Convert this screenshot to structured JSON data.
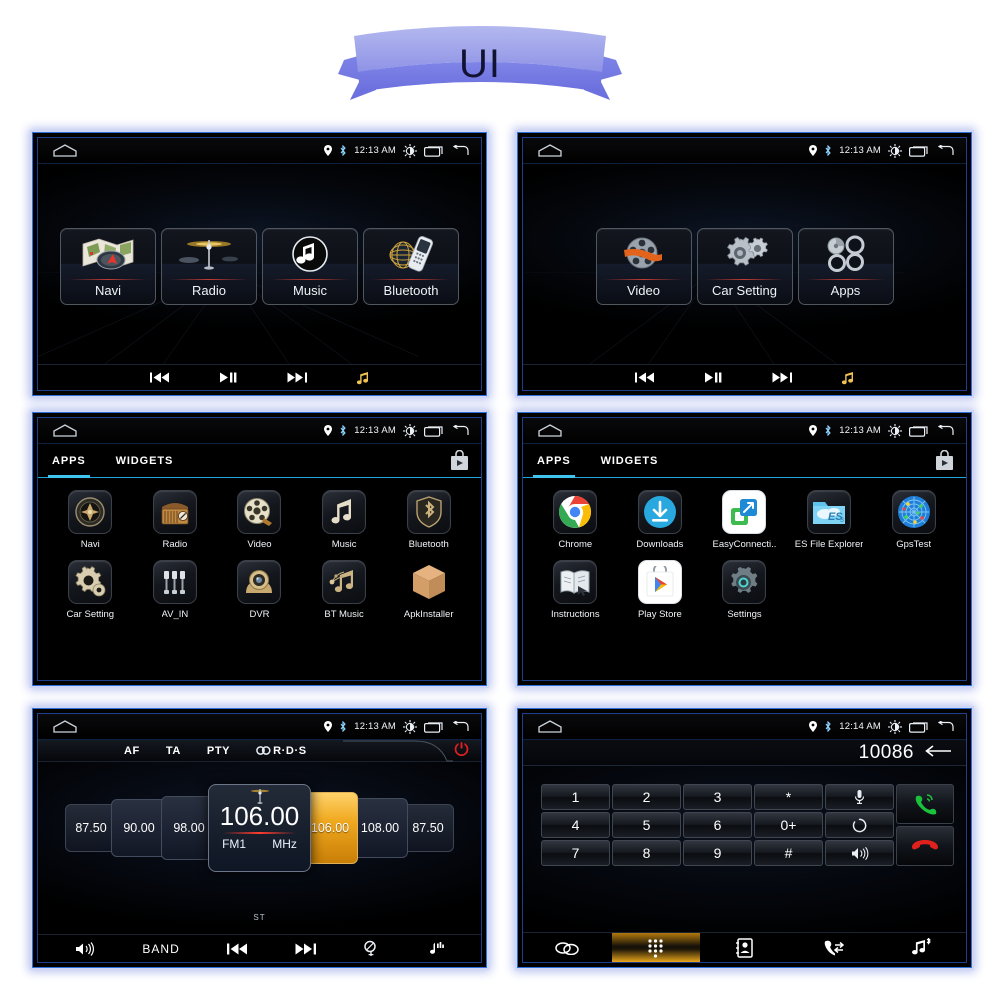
{
  "banner": {
    "title": "UI"
  },
  "status_bar": {
    "time_12_13": "12:13 AM",
    "time_12_14": "12:14 AM",
    "icons": [
      "home-icon",
      "location-icon",
      "bluetooth-icon",
      "brightness-icon",
      "recents-icon",
      "back-icon"
    ]
  },
  "panel1_home": {
    "tiles": [
      {
        "label": "Navi",
        "icon": "map-icon"
      },
      {
        "label": "Radio",
        "icon": "radio-tower-icon"
      },
      {
        "label": "Music",
        "icon": "music-note-icon"
      },
      {
        "label": "Bluetooth",
        "icon": "bt-phone-icon"
      }
    ],
    "media_controls": [
      "prev-icon",
      "play-pause-icon",
      "next-icon",
      "music-icon"
    ]
  },
  "panel2_home": {
    "tiles": [
      {
        "label": "Video",
        "icon": "film-reel-icon"
      },
      {
        "label": "Car Setting",
        "icon": "gears-icon"
      },
      {
        "label": "Apps",
        "icon": "rings-icon"
      }
    ],
    "media_controls": [
      "prev-icon",
      "play-pause-icon",
      "next-icon",
      "music-icon"
    ]
  },
  "panel3_drawer": {
    "tabs": [
      {
        "label": "APPS",
        "active": true
      },
      {
        "label": "WIDGETS",
        "active": false
      }
    ],
    "store_icon": "play-store-bag-icon",
    "apps": [
      {
        "label": "Navi",
        "icon": "compass-icon"
      },
      {
        "label": "Radio",
        "icon": "retro-radio-icon"
      },
      {
        "label": "Video",
        "icon": "film-reel-icon"
      },
      {
        "label": "Music",
        "icon": "music-note-icon"
      },
      {
        "label": "Bluetooth",
        "icon": "bt-shield-icon"
      },
      {
        "label": "Car Setting",
        "icon": "gears-icon"
      },
      {
        "label": "AV_IN",
        "icon": "rca-jacks-icon"
      },
      {
        "label": "DVR",
        "icon": "camera-icon"
      },
      {
        "label": "BT Music",
        "icon": "bt-music-icon"
      },
      {
        "label": "ApkInstaller",
        "icon": "box-icon"
      }
    ]
  },
  "panel4_drawer": {
    "tabs": [
      {
        "label": "APPS",
        "active": true
      },
      {
        "label": "WIDGETS",
        "active": false
      }
    ],
    "store_icon": "play-store-bag-icon",
    "apps": [
      {
        "label": "Chrome",
        "icon": "chrome-icon"
      },
      {
        "label": "Downloads",
        "icon": "download-icon"
      },
      {
        "label": "EasyConnecti..",
        "icon": "easyconnection-icon"
      },
      {
        "label": "ES File Explorer",
        "icon": "es-folder-icon"
      },
      {
        "label": "GpsTest",
        "icon": "gps-radar-icon"
      },
      {
        "label": "Instructions",
        "icon": "book-icon"
      },
      {
        "label": "Play Store",
        "icon": "play-store-icon"
      },
      {
        "label": "Settings",
        "icon": "settings-gear-icon"
      }
    ]
  },
  "panel5_radio": {
    "rds_items": [
      "AF",
      "TA",
      "PTY"
    ],
    "rds_logo": "R·D·S",
    "power_icon": "power-icon",
    "presets": [
      "87.50",
      "90.00",
      "98.00",
      "106.00",
      "108.00",
      "87.50"
    ],
    "highlight_preset": "106.00",
    "current_frequency": "106.00",
    "band": "FM1",
    "unit": "MHz",
    "stereo": "ST",
    "bottom_bar": {
      "volume_icon": "speaker-icon",
      "band_label": "BAND",
      "prev_icon": "prev-icon",
      "next_icon": "next-icon",
      "scan_icon": "search-icon",
      "music_icon": "music-note-icon"
    }
  },
  "panel6_dialer": {
    "number": "10086",
    "backspace_icon": "backspace-arrow-icon",
    "keys": [
      [
        "1",
        "2",
        "3",
        "*",
        "mic-icon"
      ],
      [
        "4",
        "5",
        "6",
        "0+",
        "sync-icon"
      ],
      [
        "7",
        "8",
        "9",
        "#",
        "speaker-icon"
      ]
    ],
    "call_button": "call-answer-icon",
    "hangup_button": "call-end-icon",
    "tabs": [
      {
        "icon": "link-icon",
        "active": false
      },
      {
        "icon": "keypad-icon",
        "active": true
      },
      {
        "icon": "contacts-icon",
        "active": false
      },
      {
        "icon": "calllog-icon",
        "active": false
      },
      {
        "icon": "btmusic-icon",
        "active": false
      }
    ]
  },
  "colors": {
    "accent_blue": "#3fc4f0",
    "gold": "#f0a91f",
    "red": "#ff3b2f",
    "frame_blue": "#2f6fd8"
  }
}
